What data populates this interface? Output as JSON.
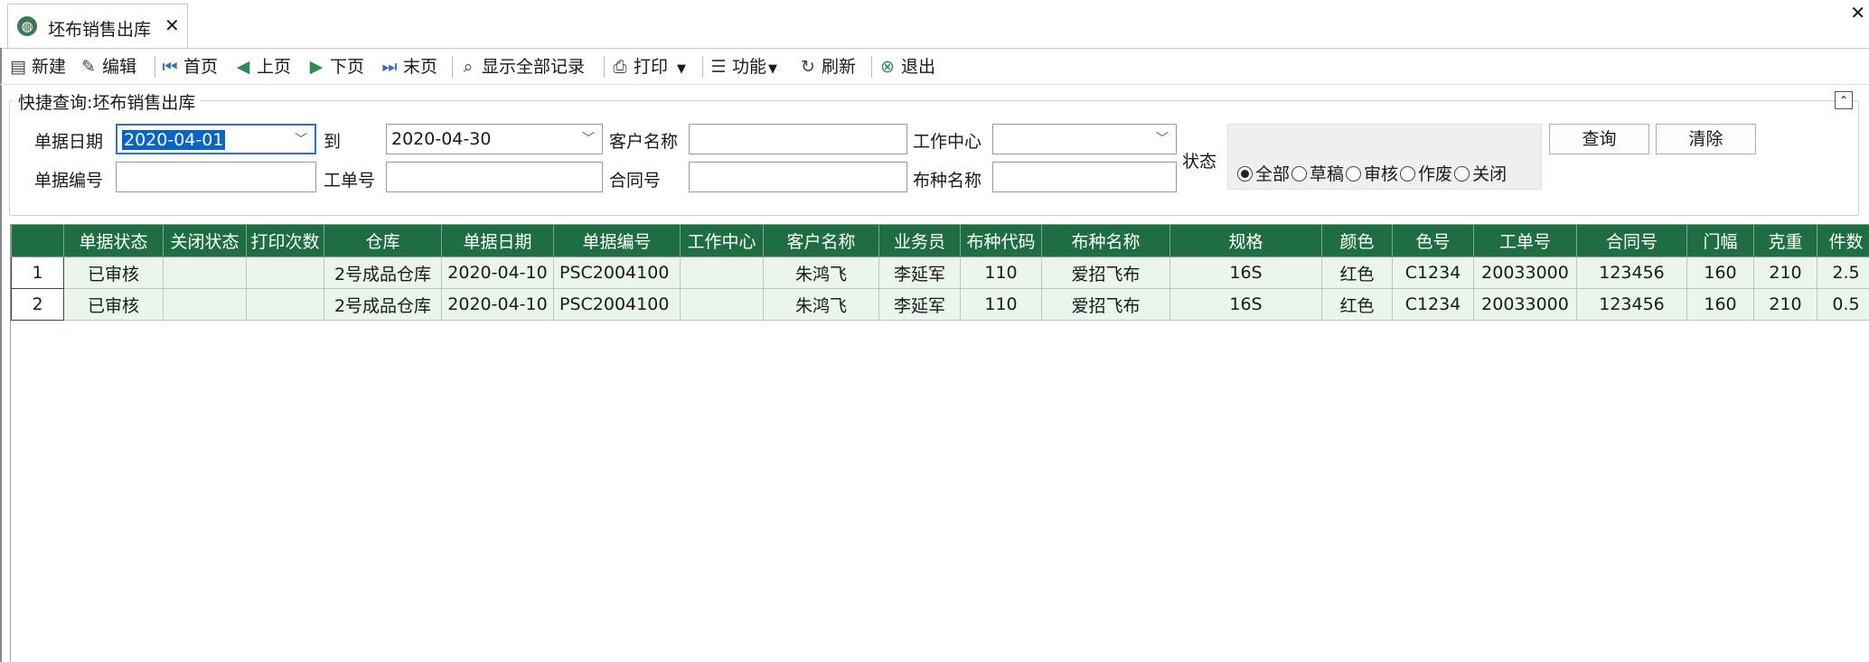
{
  "tab": {
    "title": "坯布销售出库"
  },
  "toolbar": {
    "new": "新建",
    "edit": "编辑",
    "first": "首页",
    "prev": "上页",
    "next": "下页",
    "last": "末页",
    "show_all": "显示全部记录",
    "print": "打印",
    "functions": "功能",
    "refresh": "刷新",
    "exit": "退出"
  },
  "query": {
    "title": "快捷查询:坯布销售出库",
    "date_label": "单据日期",
    "date_from": "2020-04-01",
    "to_label": "到",
    "date_to": "2020-04-30",
    "customer_label": "客户名称",
    "customer_value": "",
    "workcenter_label": "工作中心",
    "workcenter_value": "",
    "docno_label": "单据编号",
    "docno_value": "",
    "workorder_label": "工单号",
    "workorder_value": "",
    "contract_label": "合同号",
    "contract_value": "",
    "fabric_label": "布种名称",
    "fabric_value": "",
    "status_label": "状态",
    "status_options": [
      "全部",
      "草稿",
      "审核",
      "作废",
      "关闭"
    ],
    "status_selected": "全部",
    "search_button": "查询",
    "clear_button": "清除"
  },
  "grid": {
    "columns": [
      "单据状态",
      "关闭状态",
      "打印次数",
      "仓库",
      "单据日期",
      "单据编号",
      "工作中心",
      "客户名称",
      "业务员",
      "布种代码",
      "布种名称",
      "规格",
      "颜色",
      "色号",
      "工单号",
      "合同号",
      "门幅",
      "克重",
      "件数"
    ],
    "rows": [
      {
        "no": "1",
        "cells": [
          "已审核",
          "",
          "",
          "2号成品仓库",
          "2020-04-10",
          "PSC2004100",
          "",
          "朱鸿飞",
          "李延军",
          "110",
          "爱招飞布",
          "16S",
          "红色",
          "C1234",
          "20033000",
          "123456",
          "160",
          "210",
          "2.5"
        ]
      },
      {
        "no": "2",
        "cells": [
          "已审核",
          "",
          "",
          "2号成品仓库",
          "2020-04-10",
          "PSC2004100",
          "",
          "朱鸿飞",
          "李延军",
          "110",
          "爱招飞布",
          "16S",
          "红色",
          "C1234",
          "20033000",
          "123456",
          "160",
          "210",
          "0.5"
        ]
      }
    ]
  },
  "colors": {
    "header_bg": "#1f6e43",
    "row_bg": "#eaf6ec",
    "selection": "#0a64c8"
  }
}
